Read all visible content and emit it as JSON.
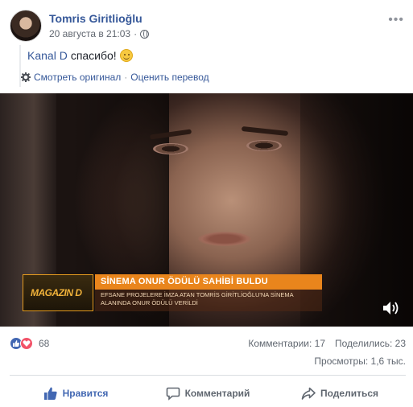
{
  "post": {
    "author": "Tomris Giritlioğlu",
    "timestamp": "20 августа в 21:03",
    "privacy_icon": "globe-icon",
    "more_icon": "more-icon",
    "text_mention": "Kanal D",
    "text_rest": "спасибо!",
    "emoji": "smile-icon",
    "see_original": "Смотреть оригинал",
    "separator": "·",
    "rate_translation": "Оценить перевод"
  },
  "video": {
    "logo_text": "MAGAZIN D",
    "headline": "SİNEMA ONUR ÖDÜLÜ SAHİBİ BULDU",
    "subheadline": "EFSANE PROJELERE İMZA ATAN TOMRİS GİRİTLİOĞLU'NA SİNEMA ALANINDA ONUR ÖDÜLÜ VERİLDİ",
    "volume_icon": "volume-icon"
  },
  "stats": {
    "reactions_count": "68",
    "comments": "Комментарии: 17",
    "shares": "Поделились: 23",
    "views": "Просмотры: 1,6 тыс."
  },
  "actions": {
    "like": "Нравится",
    "comment": "Комментарий",
    "share": "Поделиться"
  },
  "colors": {
    "link": "#365899",
    "fb_blue": "#4267b2",
    "love": "#f25268",
    "lower_third_orange": "#e9851c"
  }
}
